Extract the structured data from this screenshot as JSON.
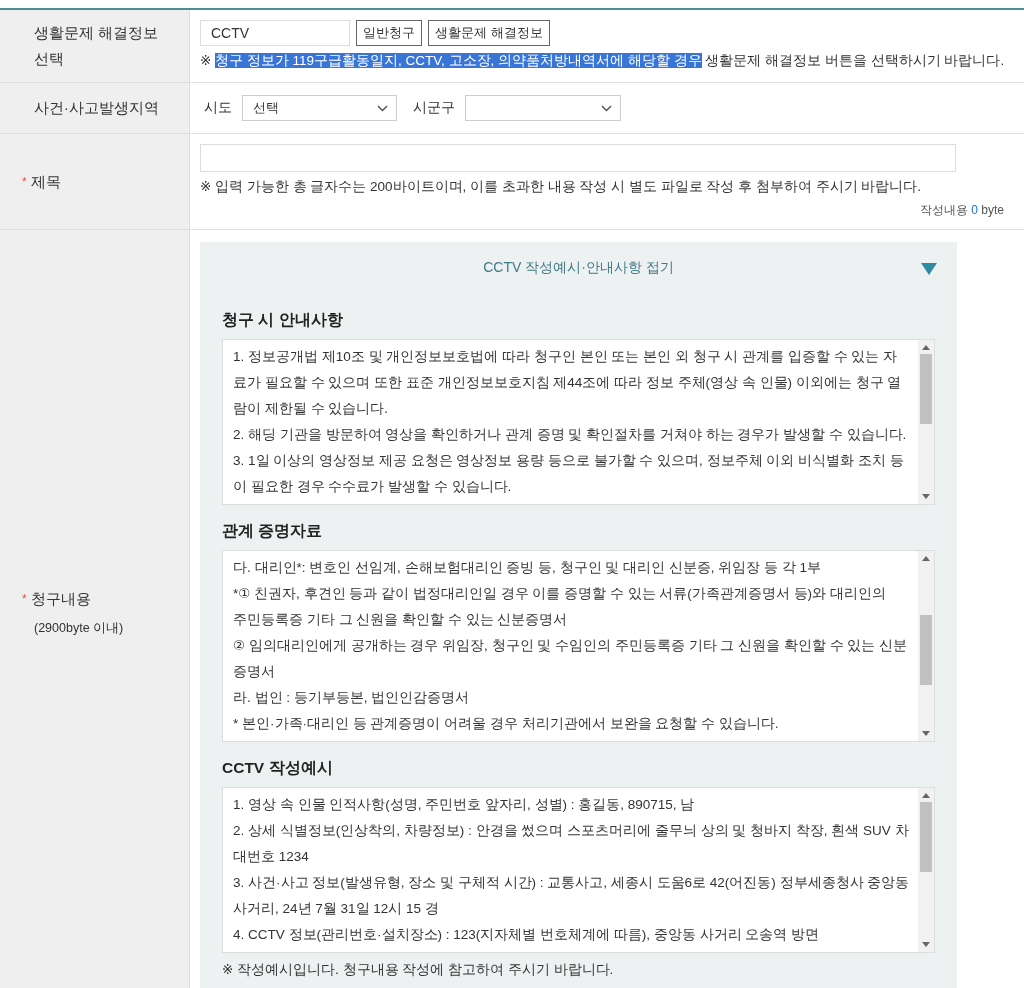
{
  "required_mark": "*",
  "rows": [
    {
      "label": "생활문제 해결정보 선택",
      "required": false
    },
    {
      "label": "사건·사고발생지역",
      "required": false
    },
    {
      "label": "제목",
      "required": true
    },
    {
      "label": "청구내용",
      "sublabel": "(2900byte 이내)",
      "required": true
    }
  ],
  "info_select": {
    "value": "CCTV",
    "buttons": [
      "일반청구",
      "생활문제 해결정보"
    ],
    "note_mark": "※",
    "note_highlighted": "청구 정보가 119구급활동일지, CCTV, 고소장, 의약품처방내역서에 해당할 경우",
    "note_rest": "생활문제 해결정보 버튼을 선택하시기 바랍니다."
  },
  "region": {
    "sido_label": "시도",
    "sido_value": "선택",
    "sigungu_label": "시군구"
  },
  "title_field": {
    "note": "※ 입력 가능한 총 글자수는 200바이트이며, 이를 초과한 내용 작성 시 별도 파일로 작성 후 첨부하여 주시기 바랍니다.",
    "counter_label": "작성내용",
    "counter_value": "0",
    "counter_unit": "byte"
  },
  "guide": {
    "toggle_label": "CCTV 작성예시·안내사항 접기",
    "expanded": true,
    "sections": [
      {
        "heading": "청구 시 안내사항",
        "lines": [
          "1. 정보공개법 제10조 및 개인정보보호법에 따라 청구인 본인 또는 본인 외 청구 시 관계를 입증할 수 있는 자료가 필요할 수 있으며 또한 표준 개인정보보호지침 제44조에 따라 정보 주체(영상 속 인물) 이외에는 청구 열람이 제한될 수 있습니다.",
          "2. 해딩 기관을 방문하여 영상을 확인하거나 관계 증명 및 확인절차를 거쳐야 하는 경우가 발생할 수 있습니다.",
          "3. 1일 이상의 영상정보 제공 요청은 영상정보 용량 등으로 불가할 수 있으며, 정보주체 이외 비식별화 조치 등이 필요한 경우 수수료가 발생할 수 있습니다."
        ]
      },
      {
        "heading": "관계 증명자료",
        "lines": [
          "다. 대리인*: 변호인 선임계, 손해보험대리인 증빙 등, 청구인 및 대리인 신분증, 위임장 등  각 1부",
          "*① 친권자, 후견인 등과 같이 법정대리인일 경우 이를 증명할 수 있는 서류(가족관계증명서 등)와 대리인의",
          "주민등록증 기타 그 신원을 확인할 수 있는 신분증명서",
          "② 임의대리인에게 공개하는 경우 위임장, 청구인 및 수임인의 주민등록증 기타 그 신원을 확인할 수 있는 신분증명서",
          "라. 법인 : 등기부등본, 법인인감증명서",
          "* 본인·가족·대리인 등 관계증명이 어려울 경우 처리기관에서 보완을 요청할 수 있습니다."
        ]
      },
      {
        "heading": "CCTV 작성예시",
        "lines": [
          "1. 영상 속 인물 인적사항(성명, 주민번호 앞자리, 성별) : 홍길동, 890715, 남",
          "2. 상세 식별정보(인상착의, 차량정보) : 안경을 썼으며 스포츠머리에 줄무늬 상의 및 청바지 착장, 흰색 SUV 차대번호 1234",
          "3. 사건·사고 정보(발생유형, 장소 및 구체적 시간) : 교통사고, 세종시 도움6로 42(어진동) 정부세종청사 중앙동 사거리, 24년 7월 31일 12시 15 경",
          "4. CCTV 정보(관리번호·설치장소) : 123(지자체별 번호체계에 따름), 중앙동 사거리 오송역 방면"
        ],
        "footnote": "※ 작성예시입니다. 청구내용 작성에 참고하여 주시기 바랍니다."
      }
    ]
  }
}
